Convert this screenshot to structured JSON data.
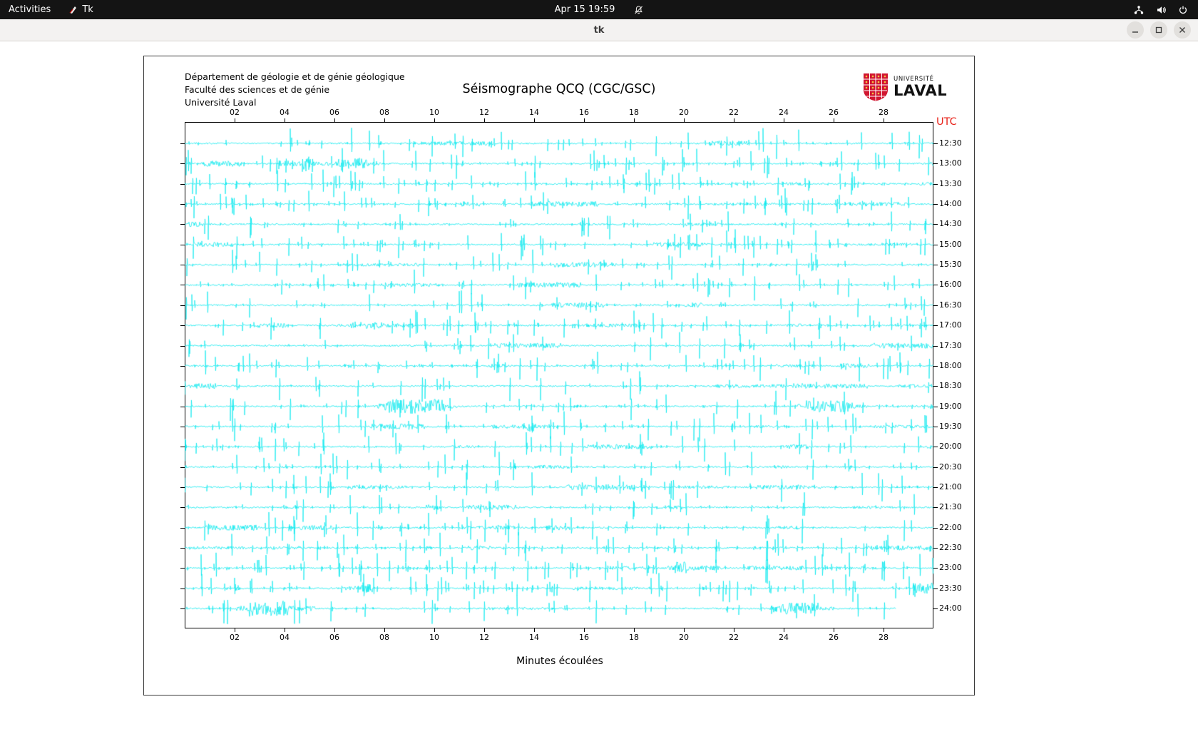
{
  "top_bar": {
    "activities": "Activities",
    "app_indicator": "Tk",
    "clock": "Apr 15 19:59",
    "icons": [
      "tk-icon",
      "bell-muted-icon",
      "network-icon",
      "volume-icon",
      "power-icon"
    ]
  },
  "window": {
    "title": "tk",
    "controls": [
      "minimize",
      "maximize",
      "close"
    ]
  },
  "app": {
    "institution_lines": [
      "Département de géologie et de génie géologique",
      "Faculté des sciences et de génie",
      "Université Laval"
    ],
    "title": "Séismographe QCQ (CGC/GSC)",
    "logo": {
      "line1": "UNIVERSITÉ",
      "line2": "LAVAL"
    },
    "utc_label": "UTC",
    "xlabel": "Minutes écoulées",
    "x_ticks": [
      "02",
      "04",
      "06",
      "08",
      "10",
      "12",
      "14",
      "16",
      "18",
      "20",
      "22",
      "24",
      "26",
      "28"
    ],
    "x_range_minutes": [
      0,
      30
    ],
    "trace_labels": [
      "12:30",
      "13:00",
      "13:30",
      "14:00",
      "14:30",
      "15:00",
      "15:30",
      "16:00",
      "16:30",
      "17:00",
      "17:30",
      "18:00",
      "18:30",
      "19:00",
      "19:30",
      "20:00",
      "20:30",
      "21:00",
      "21:30",
      "22:00",
      "22:30",
      "23:00",
      "23:30",
      "24:00"
    ],
    "trace_color": "#00e8ee",
    "utc_color": "#e8251c",
    "logo_color": "#d11630",
    "last_trace_fraction": 0.95
  }
}
